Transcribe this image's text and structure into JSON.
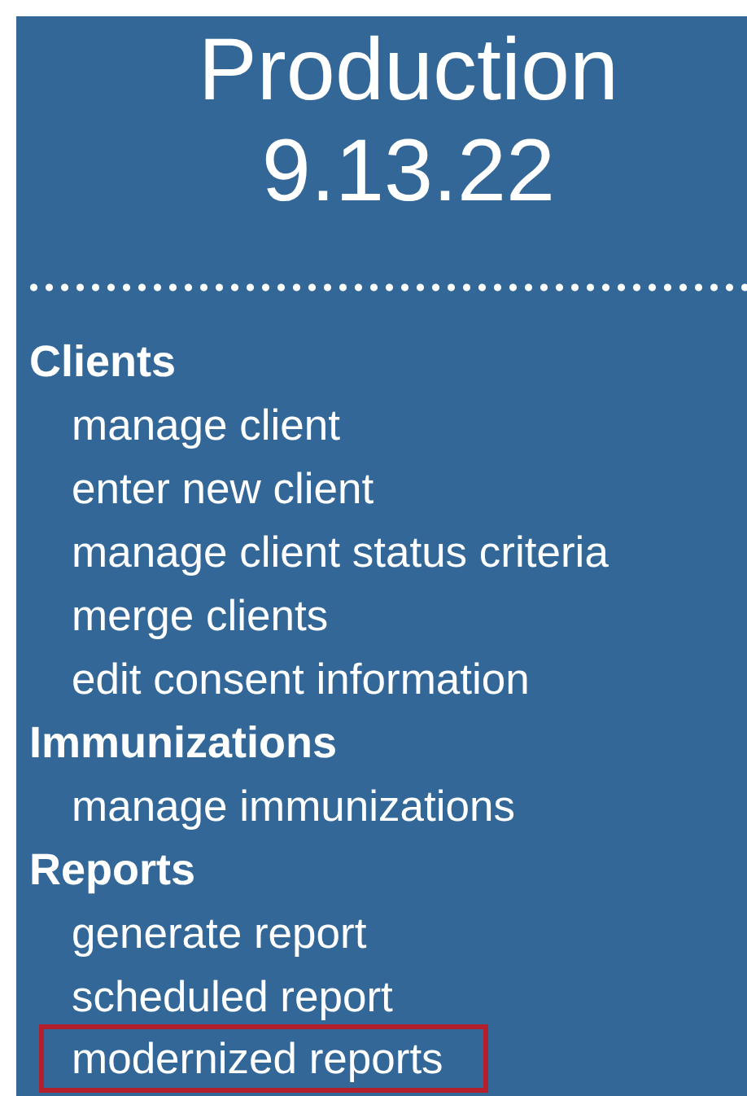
{
  "title": "Production",
  "version": "9.13.22",
  "sections": [
    {
      "heading": "Clients",
      "items": [
        {
          "label": "manage client",
          "highlighted": false
        },
        {
          "label": "enter new client",
          "highlighted": false
        },
        {
          "label": "manage client status criteria",
          "highlighted": false
        },
        {
          "label": "merge clients",
          "highlighted": false
        },
        {
          "label": "edit consent information",
          "highlighted": false
        }
      ]
    },
    {
      "heading": "Immunizations",
      "items": [
        {
          "label": "manage immunizations",
          "highlighted": false
        }
      ]
    },
    {
      "heading": "Reports",
      "items": [
        {
          "label": "generate report",
          "highlighted": false
        },
        {
          "label": "scheduled report",
          "highlighted": false
        },
        {
          "label": "modernized reports",
          "highlighted": true
        }
      ]
    }
  ]
}
